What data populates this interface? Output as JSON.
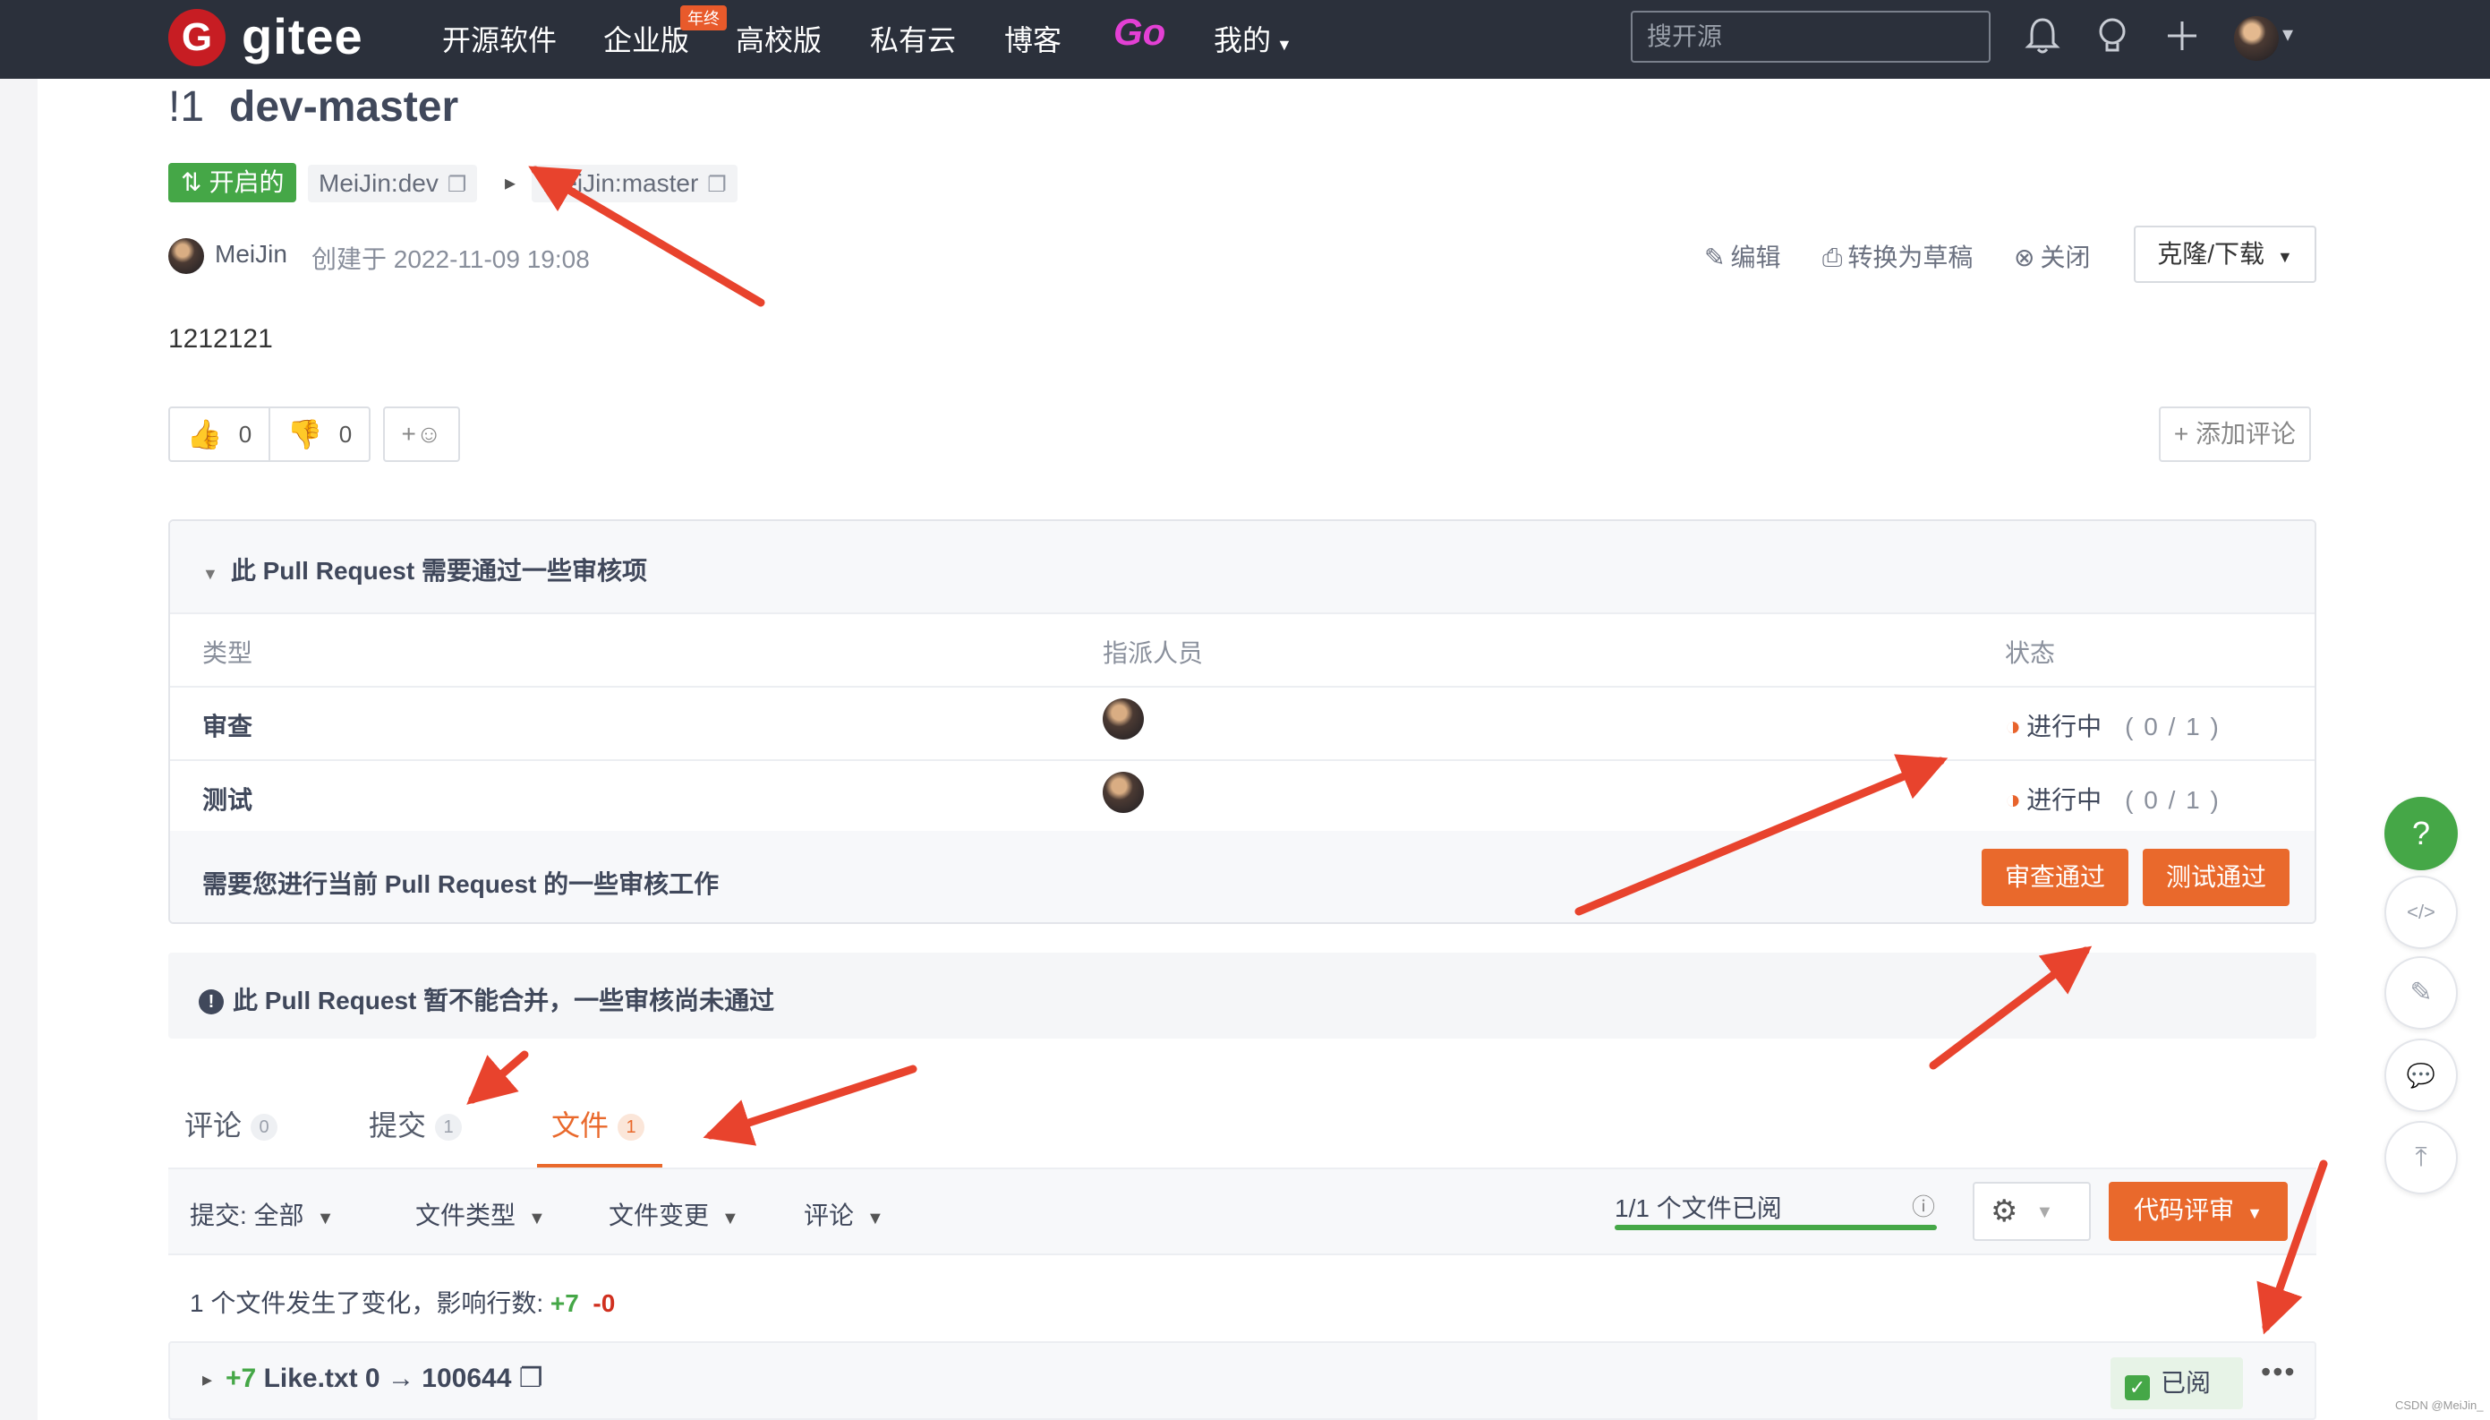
{
  "nav": {
    "logo_badge": "G",
    "logo_text": "gitee",
    "links": [
      "开源软件",
      "企业版",
      "高校版",
      "私有云",
      "博客"
    ],
    "go_link": "Go",
    "my_menu": "我的",
    "year_tag": "年终",
    "search_placeholder": "搜开源"
  },
  "pr": {
    "number": "!1",
    "title": "dev-master",
    "state": "开启的",
    "source_branch": "MeiJin:dev",
    "target_branch": "MeiJin:master",
    "author": "MeiJin",
    "created": "创建于 2022-11-09 19:08",
    "actions": {
      "edit": "编辑",
      "draft": "转换为草稿",
      "close": "关闭",
      "clone": "克隆/下载"
    },
    "description": "1212121"
  },
  "reactions": {
    "thumbs_up": "0",
    "thumbs_down": "0",
    "emoji": "+☺",
    "add_comment": "+ 添加评论"
  },
  "review": {
    "title": "此 Pull Request 需要通过一些审核项",
    "headers": {
      "type": "类型",
      "assignee": "指派人员",
      "status": "状态"
    },
    "rows": [
      {
        "type": "审查",
        "status": "进行中",
        "count": "( 0 / 1 )"
      },
      {
        "type": "测试",
        "status": "进行中",
        "count": "( 0 / 1 )"
      }
    ],
    "note": "需要您进行当前 Pull Request 的一些审核工作",
    "btn_review": "审查通过",
    "btn_test": "测试通过"
  },
  "merge_warning": "此 Pull Request 暂不能合并，一些审核尚未通过",
  "tabs": [
    {
      "label": "评论",
      "count": "0"
    },
    {
      "label": "提交",
      "count": "1"
    },
    {
      "label": "文件",
      "count": "1"
    }
  ],
  "filters": {
    "commit": "提交:  全部",
    "file_type": "文件类型",
    "file_change": "文件变更",
    "comment": "评论",
    "viewed": "1/1 个文件已阅",
    "viewed_progress": 1.0,
    "code_review": "代码评审"
  },
  "summary": {
    "text": "1 个文件发生了变化，影响行数:",
    "plus": "+7",
    "minus": "-0"
  },
  "file": {
    "plus": "+7",
    "name": "Like.txt 0 → 100644",
    "viewed": "已阅"
  },
  "floats": [
    "?",
    "</>",
    "✎",
    "💬",
    "⤒"
  ],
  "watermark": "CSDN @MeiJin_",
  "colors": {
    "nav_bg": "#2b303b",
    "accent_orange": "#e9692c",
    "green": "#45a747",
    "brand_red": "#c71d23",
    "arrow_red": "#e8432d"
  }
}
